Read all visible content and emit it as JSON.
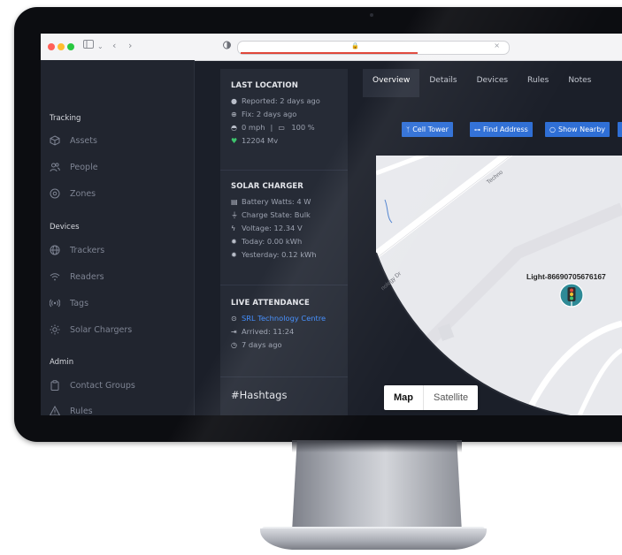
{
  "sidebar": {
    "sections": [
      {
        "title": "Tracking",
        "items": [
          {
            "label": "Assets",
            "icon": "cube-icon"
          },
          {
            "label": "People",
            "icon": "people-icon"
          },
          {
            "label": "Zones",
            "icon": "target-icon"
          }
        ]
      },
      {
        "title": "Devices",
        "items": [
          {
            "label": "Trackers",
            "icon": "globe-icon"
          },
          {
            "label": "Readers",
            "icon": "wifi-icon"
          },
          {
            "label": "Tags",
            "icon": "radio-icon"
          },
          {
            "label": "Solar Chargers",
            "icon": "sun-icon"
          }
        ]
      },
      {
        "title": "Admin",
        "items": [
          {
            "label": "Contact Groups",
            "icon": "clipboard-icon"
          },
          {
            "label": "Rules",
            "icon": "warning-icon"
          }
        ]
      }
    ]
  },
  "last_location": {
    "title": "LAST LOCATION",
    "reported": "Reported: 2 days ago",
    "fix": "Fix: 2 days ago",
    "speed": "0 mph",
    "separator": "|",
    "battery": "100 %",
    "voltage": "12204 Mv"
  },
  "solar_charger": {
    "title": "SOLAR CHARGER",
    "battery_watts": "Battery Watts: 4 W",
    "charge_state": "Charge State: Bulk",
    "voltage": "Voltage: 12.34 V",
    "today": "Today: 0.00 kWh",
    "yesterday": "Yesterday: 0.12 kWh"
  },
  "live_attendance": {
    "title": "LIVE ATTENDANCE",
    "location": "SRL Technology Centre",
    "arrived": "Arrived: 11:24",
    "ago": "7 days ago"
  },
  "hashtags": {
    "title": "#Hashtags"
  },
  "tabs": [
    "Overview",
    "Details",
    "Devices",
    "Rules",
    "Notes"
  ],
  "actions": [
    "Cell Tower",
    "Find Address",
    "Show Nearby"
  ],
  "map": {
    "marker_label": "Light-86690705676167",
    "road_labels": [
      "Techno",
      "nology Dr"
    ],
    "toggle": {
      "map": "Map",
      "satellite": "Satellite"
    }
  },
  "colors": {
    "accent": "#2f6fd6",
    "link": "#3f8cff",
    "voltage_icon": "#3ec46d",
    "marker": "#2e8a96"
  }
}
